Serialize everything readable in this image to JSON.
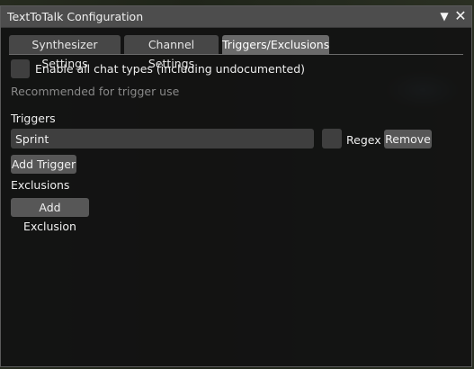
{
  "window": {
    "title": "TextToTalk Configuration",
    "collapse_icon": "triangle-down-icon",
    "close_icon": "close-x-icon"
  },
  "tabs": [
    {
      "label": "Synthesizer Settings",
      "active": false
    },
    {
      "label": "Channel Settings",
      "active": false
    },
    {
      "label": "Triggers/Exclusions",
      "active": true
    }
  ],
  "enable_all": {
    "label": "Enable all chat types (including undocumented)",
    "checked": false,
    "hint": "Recommended for trigger use"
  },
  "triggers": {
    "heading": "Triggers",
    "items": [
      {
        "value": "Sprint",
        "regex_label": "Regex",
        "regex_checked": false,
        "remove_label": "Remove"
      }
    ],
    "add_label": "Add Trigger"
  },
  "exclusions": {
    "heading": "Exclusions",
    "add_label": "Add Exclusion"
  }
}
